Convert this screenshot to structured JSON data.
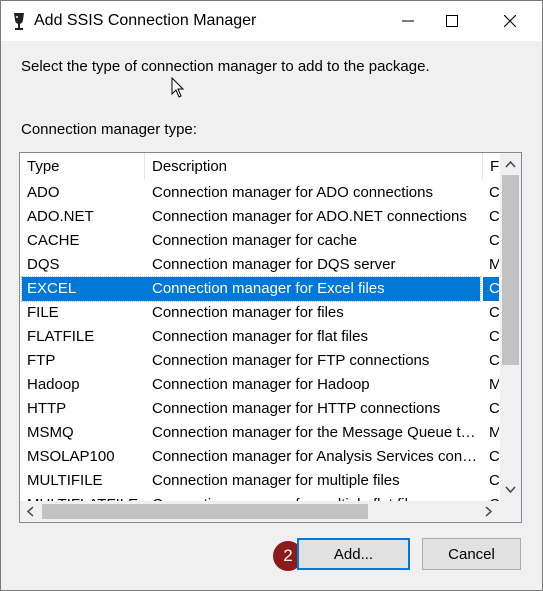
{
  "window": {
    "title": "Add SSIS Connection Manager",
    "icon": "ssis-icon"
  },
  "instruction": "Select the type of connection manager to add to the package.",
  "list_label": "Connection manager type:",
  "list": {
    "columns": [
      "Type",
      "Description",
      "Fi"
    ],
    "rows": [
      {
        "type": "ADO",
        "description": "Connection manager for ADO connections",
        "file": "C"
      },
      {
        "type": "ADO.NET",
        "description": "Connection manager for ADO.NET connections",
        "file": "C"
      },
      {
        "type": "CACHE",
        "description": "Connection manager for cache",
        "file": "C"
      },
      {
        "type": "DQS",
        "description": "Connection manager for DQS server",
        "file": "M"
      },
      {
        "type": "EXCEL",
        "description": "Connection manager for Excel files",
        "file": "C",
        "selected": true
      },
      {
        "type": "FILE",
        "description": "Connection manager for files",
        "file": "C"
      },
      {
        "type": "FLATFILE",
        "description": "Connection manager for flat files",
        "file": "C"
      },
      {
        "type": "FTP",
        "description": "Connection manager for FTP connections",
        "file": "C"
      },
      {
        "type": "Hadoop",
        "description": "Connection manager for Hadoop",
        "file": "M"
      },
      {
        "type": "HTTP",
        "description": "Connection manager for HTTP connections",
        "file": "C"
      },
      {
        "type": "MSMQ",
        "description": "Connection manager for the Message Queue task",
        "file": "M"
      },
      {
        "type": "MSOLAP100",
        "description": "Connection manager for Analysis Services conn...",
        "file": "C"
      },
      {
        "type": "MULTIFILE",
        "description": "Connection manager for multiple files",
        "file": "C"
      },
      {
        "type": "MULTIFLATFILE",
        "description": "Connection manager for multiple flat files",
        "file": "C"
      }
    ]
  },
  "buttons": {
    "add": "Add...",
    "cancel": "Cancel"
  },
  "step_badge": "2",
  "colors": {
    "selection": "#0078d7",
    "badge": "#8b1a1a"
  }
}
